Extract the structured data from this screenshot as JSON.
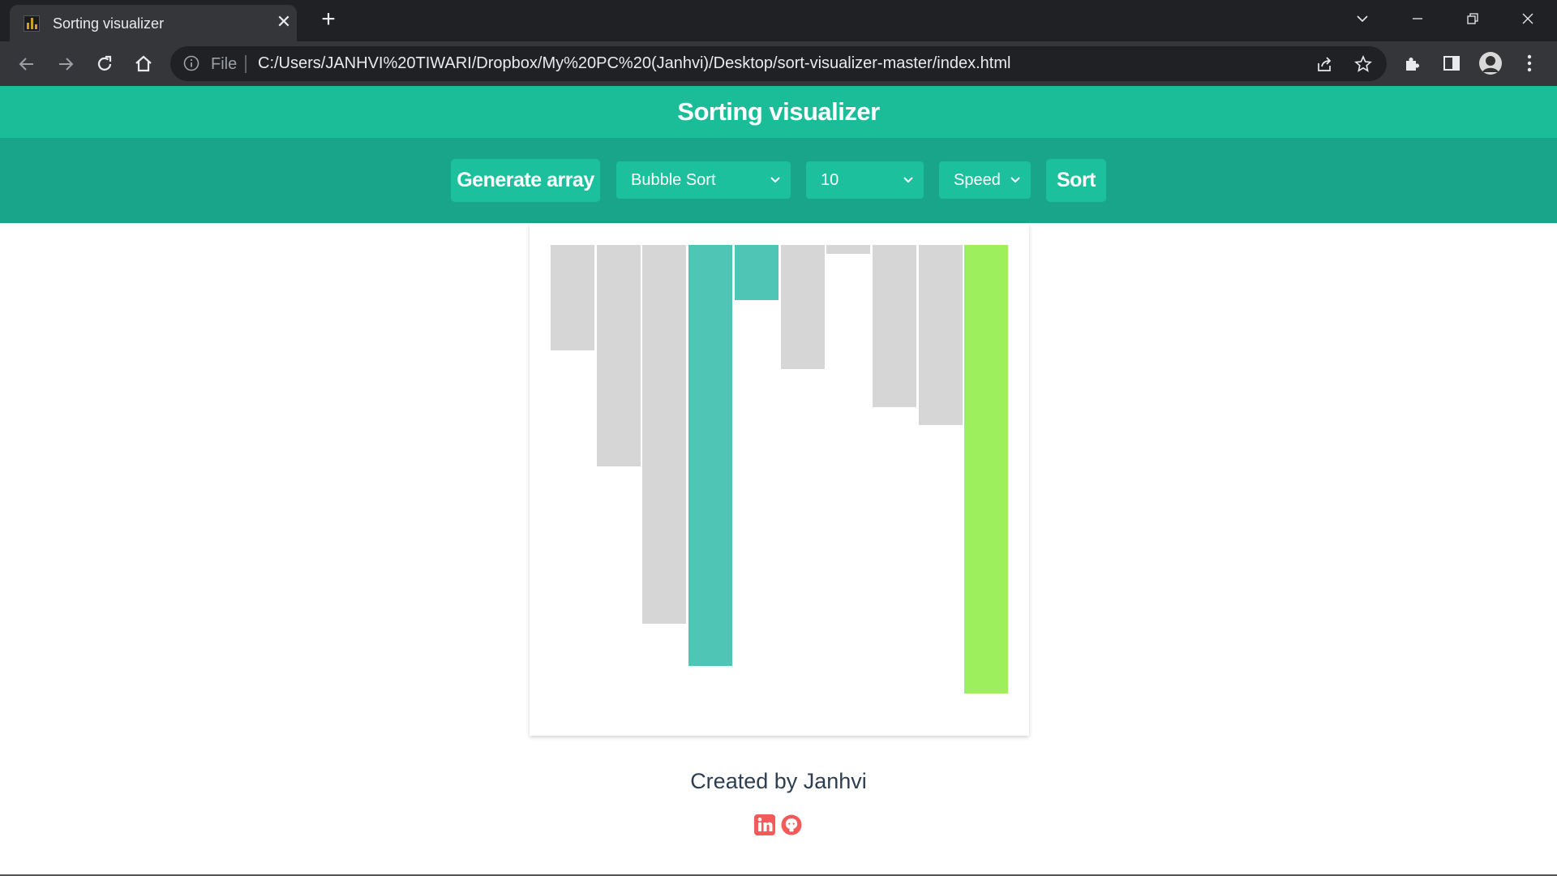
{
  "browser": {
    "tab": {
      "title": "Sorting visualizer"
    },
    "omnibox": {
      "scheme_label": "File",
      "url": "C:/Users/JANHVI%20TIWARI/Dropbox/My%20PC%20(Janhvi)/Desktop/sort-visualizer-master/index.html"
    }
  },
  "header": {
    "title": "Sorting visualizer"
  },
  "controls": {
    "generate_label": "Generate array",
    "algorithm_selected": "Bubble Sort",
    "size_selected": "10",
    "speed_selected": "Speed",
    "sort_label": "Sort"
  },
  "array": {
    "values": [
      130,
      273,
      467,
      519,
      68,
      153,
      11,
      200,
      222,
      553
    ],
    "states": [
      "default",
      "default",
      "default",
      "comparing",
      "comparing",
      "default",
      "default",
      "default",
      "default",
      "sorted"
    ]
  },
  "colors": {
    "default": "#d6d6d6",
    "comparing": "#4fc5b6",
    "sorted": "#9def5d",
    "header": "#1bbd99",
    "controls": "#18a58a",
    "buttons": "#1dc09c",
    "social": "#f35a5a"
  },
  "footer": {
    "credit": "Created by Janhvi",
    "icons": [
      "linkedin-icon",
      "github-icon"
    ]
  }
}
